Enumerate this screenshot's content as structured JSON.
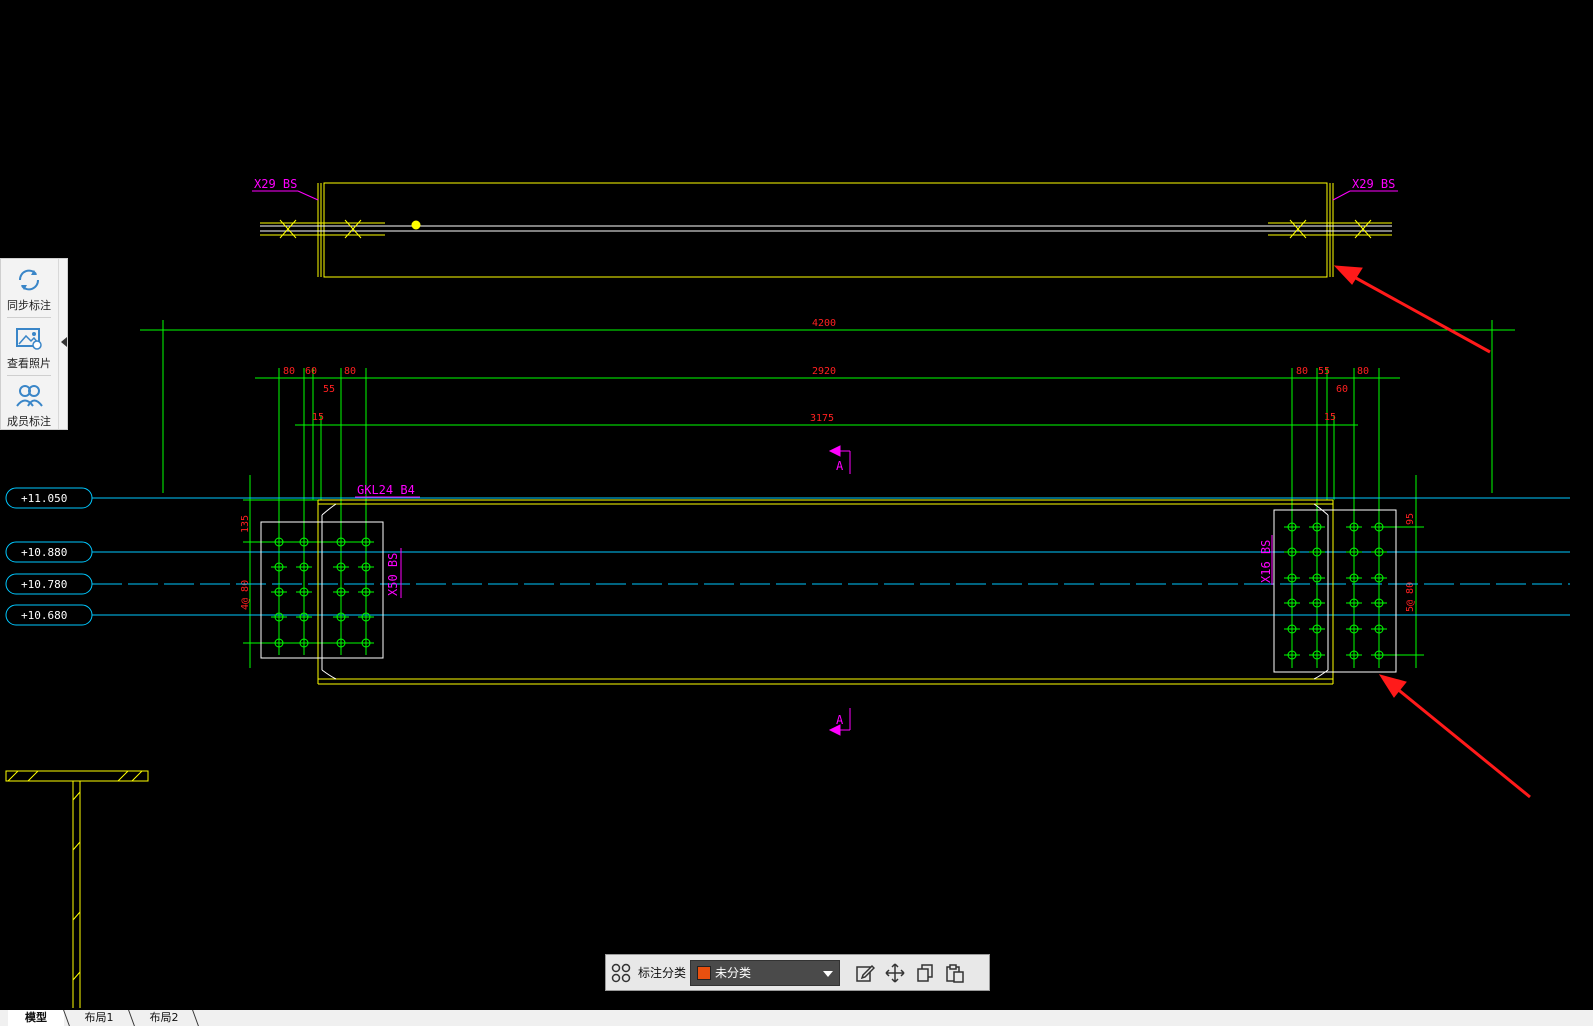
{
  "colors": {
    "background": "#000000",
    "yellow": "#ffff00",
    "green": "#00ff00",
    "cyan": "#00c8ff",
    "magenta": "#ff00ff",
    "red": "#ff2020",
    "white": "#ffffff",
    "arrow": "#ff1a1a",
    "category_swatch": "#e8500f"
  },
  "drawing": {
    "section_label_left": "X29 BS",
    "section_label_right": "X29 BS",
    "beam_label": "GKL24 B4",
    "plate_label_left": "X50 BS",
    "plate_label_right": "X16 BS",
    "section_mark": "A",
    "dims": {
      "overall": "4200",
      "inner": "2920",
      "mid": "3175",
      "left_80a": "80",
      "left_60": "60",
      "left_80b": "80",
      "left_55": "55",
      "left_15": "15",
      "right_80a": "80",
      "right_55": "55",
      "right_80b": "80",
      "right_60": "60",
      "right_15": "15",
      "left_vertical_top": "135",
      "left_vertical_main": "4@ 80",
      "right_vertical_top": "95",
      "right_vertical_main": "5@ 80"
    },
    "elevations": [
      "+11.050",
      "+10.880",
      "+10.780",
      "+10.680"
    ]
  },
  "side_panel": {
    "items": [
      {
        "label": "同步标注",
        "icon": "sync-icon"
      },
      {
        "label": "查看照片",
        "icon": "photo-icon"
      },
      {
        "label": "成员标注",
        "icon": "members-icon"
      }
    ]
  },
  "toolbar": {
    "category_label": "标注分类",
    "category_value": "未分类"
  },
  "tabs": [
    {
      "label": "模型",
      "active": true
    },
    {
      "label": "布局1",
      "active": false
    },
    {
      "label": "布局2",
      "active": false
    }
  ]
}
